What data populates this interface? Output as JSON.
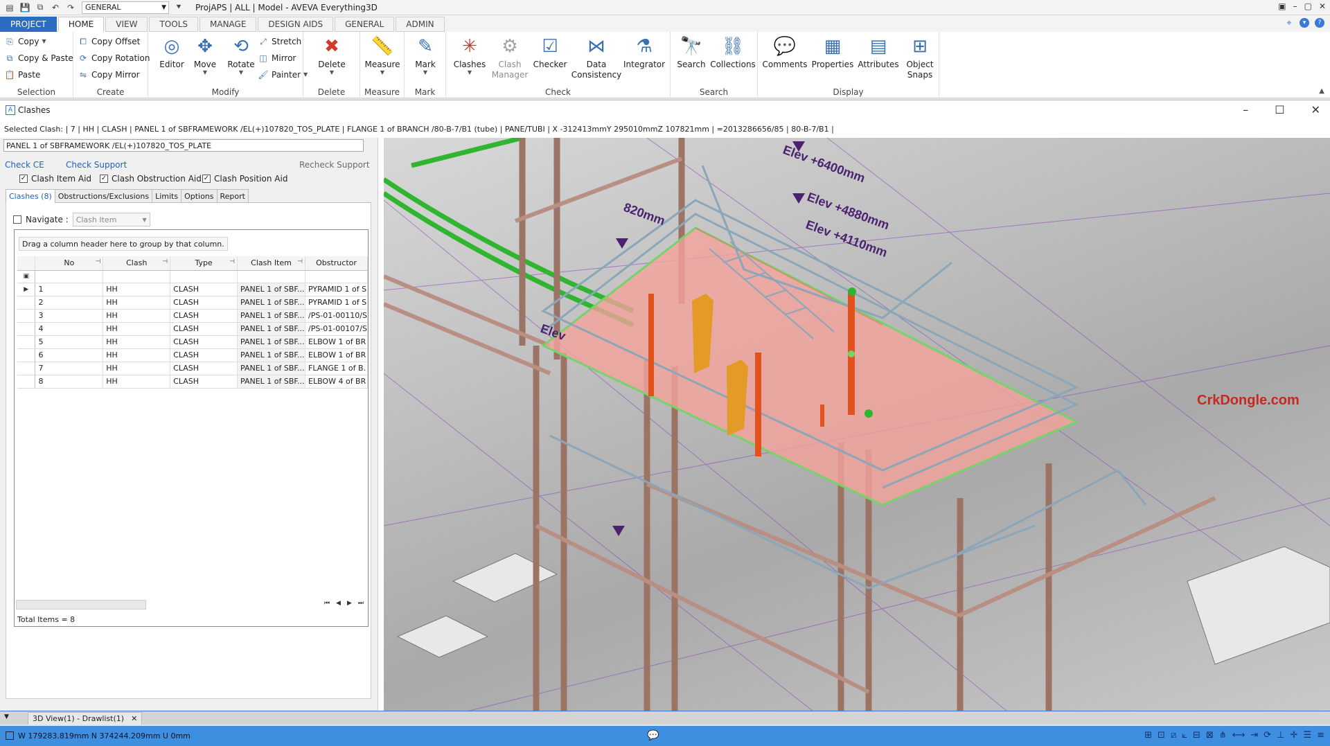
{
  "titlebar": {
    "module": "GENERAL",
    "title": "ProjAPS | ALL | Model - AVEVA Everything3D"
  },
  "tabs": [
    "PROJECT",
    "HOME",
    "VIEW",
    "TOOLS",
    "MANAGE",
    "DESIGN AIDS",
    "GENERAL",
    "ADMIN"
  ],
  "ribbon": {
    "selection": {
      "label": "Selection",
      "copy": "Copy",
      "copy_paste": "Copy & Paste",
      "paste": "Paste"
    },
    "create": {
      "label": "Create",
      "copy_offset": "Copy Offset",
      "copy_rotation": "Copy Rotation",
      "copy_mirror": "Copy Mirror"
    },
    "modify": {
      "label": "Modify",
      "editor": "Editor",
      "move": "Move",
      "rotate": "Rotate",
      "stretch": "Stretch",
      "mirror": "Mirror",
      "painter": "Painter"
    },
    "delete": {
      "label": "Delete",
      "delete": "Delete"
    },
    "measure": {
      "label": "Measure",
      "measure": "Measure"
    },
    "mark": {
      "label": "Mark",
      "mark": "Mark"
    },
    "check": {
      "label": "Check",
      "clashes": "Clashes",
      "clash_manager": "Clash Manager",
      "checker": "Checker",
      "data_consistency": "Data Consistency",
      "integrator": "Integrator"
    },
    "search": {
      "label": "Search",
      "search": "Search",
      "collections": "Collections"
    },
    "display": {
      "label": "Display",
      "comments": "Comments",
      "properties": "Properties",
      "attributes": "Attributes",
      "object_snaps": "Object Snaps"
    }
  },
  "clashes_window": {
    "title": "Clashes",
    "selected_clash": "Selected Clash: |   7 | HH | CLASH | PANEL 1 of SBFRAMEWORK /EL(+)107820_TOS_PLATE | FLANGE 1 of BRANCH /80-B-7/B1 (tube) | PANE/TUBI | X -312413mmY 295010mmZ 107821mm | =2013286656/85 | 80-B-7/B1 |",
    "ce_value": "PANEL 1 of SBFRAMEWORK /EL(+)107820_TOS_PLATE",
    "check_ce": "Check CE",
    "check_support": "Check Support",
    "recheck_support": "Recheck Support",
    "aids": [
      {
        "label": "Clash Item Aid",
        "checked": "✓"
      },
      {
        "label": "Clash Obstruction Aid",
        "checked": "✓"
      },
      {
        "label": "Clash Position Aid",
        "checked": "✓"
      }
    ],
    "subtabs": [
      "Clashes (8)",
      "Obstructions/Exclusions",
      "Limits",
      "Options",
      "Report"
    ],
    "navigate_label": "Navigate :",
    "navigate_select": "Clash Item",
    "group_hint": "Drag a column header here to group by that column.",
    "columns": [
      "No",
      "Clash",
      "Type",
      "Clash Item",
      "Obstructor"
    ],
    "rows": [
      {
        "no": "1",
        "clash": "HH",
        "type": "CLASH",
        "item": "PANEL 1 of SBF...",
        "obstructor": "PYRAMID 1 of S"
      },
      {
        "no": "2",
        "clash": "HH",
        "type": "CLASH",
        "item": "PANEL 1 of SBF...",
        "obstructor": "PYRAMID 1 of S"
      },
      {
        "no": "3",
        "clash": "HH",
        "type": "CLASH",
        "item": "PANEL 1 of SBF...",
        "obstructor": "/PS-01-00110/S"
      },
      {
        "no": "4",
        "clash": "HH",
        "type": "CLASH",
        "item": "PANEL 1 of SBF...",
        "obstructor": "/PS-01-00107/S"
      },
      {
        "no": "5",
        "clash": "HH",
        "type": "CLASH",
        "item": "PANEL 1 of SBF...",
        "obstructor": "ELBOW 1 of BR"
      },
      {
        "no": "6",
        "clash": "HH",
        "type": "CLASH",
        "item": "PANEL 1 of SBF...",
        "obstructor": "ELBOW 1 of BR"
      },
      {
        "no": "7",
        "clash": "HH",
        "type": "CLASH",
        "item": "PANEL 1 of SBF...",
        "obstructor": "FLANGE 1 of B."
      },
      {
        "no": "8",
        "clash": "HH",
        "type": "CLASH",
        "item": "PANEL 1 of SBF...",
        "obstructor": "ELBOW 4 of BR"
      }
    ],
    "total": "Total Items = 8"
  },
  "viewport": {
    "labels": [
      "Elev +6400mm",
      "Elev +4880mm",
      "Elev +4110mm",
      "820mm",
      "Elev"
    ],
    "watermark": "CrkDongle.com"
  },
  "doc_tab": "3D View(1) - Drawlist(1)",
  "status": {
    "coords": "W 179283.819mm N 374244.209mm U 0mm"
  },
  "colors": {
    "accent": "#2b6cc4",
    "statusbar": "#3e8fe0",
    "clash_panel": "#f4a39a",
    "steel": "#b88f82",
    "pipe_green": "#2fb52f",
    "pipe_orange": "#e2521d",
    "handrail": "#8aa6b8"
  }
}
